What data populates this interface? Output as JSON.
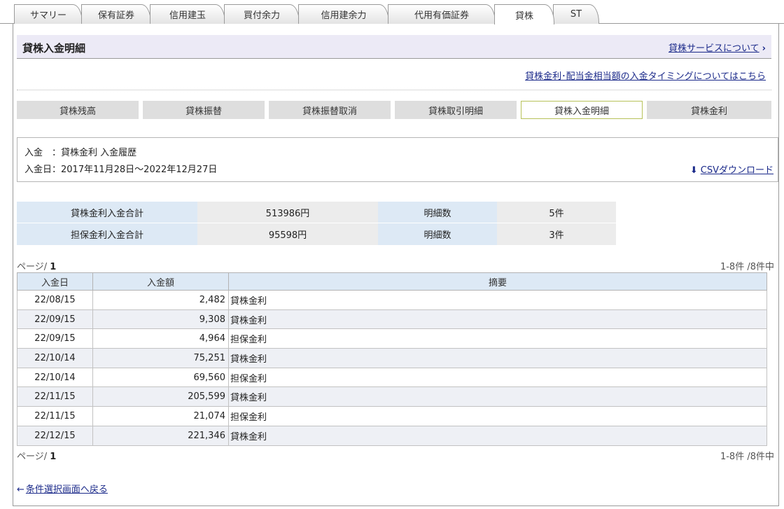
{
  "tabs": [
    "サマリー",
    "保有証券",
    "信用建玉",
    "買付余力",
    "信用建余力",
    "代用有価証券",
    "貸株",
    "ST"
  ],
  "header": {
    "title": "貸株入金明細",
    "service_link": "貸株サービスについて",
    "timing_link": "貸株金利･配当金相当額の入金タイミングについてはこちら"
  },
  "subnav": [
    "貸株残高",
    "貸株振替",
    "貸株振替取消",
    "貸株取引明細",
    "貸株入金明細",
    "貸株金利"
  ],
  "criteria": {
    "line1": "入金　：貸株金利  入金履歴",
    "line2": "入金日：2017年11月28日～2022年12月27日",
    "csv_label": "CSVダウンロード"
  },
  "summary": [
    {
      "label": "貸株金利入金合計",
      "amount": "513986円",
      "count_label": "明細数",
      "count": "5件"
    },
    {
      "label": "担保金利入金合計",
      "amount": "95598円",
      "count_label": "明細数",
      "count": "3件"
    }
  ],
  "pager": {
    "prefix": "ページ/ ",
    "page": "1",
    "range": "1-8件 /8件中"
  },
  "detail": {
    "headers": [
      "入金日",
      "入金額",
      "摘要"
    ],
    "rows": [
      {
        "date": "22/08/15",
        "amount": "2,482",
        "desc": "貸株金利"
      },
      {
        "date": "22/09/15",
        "amount": "9,308",
        "desc": "貸株金利"
      },
      {
        "date": "22/09/15",
        "amount": "4,964",
        "desc": "担保金利"
      },
      {
        "date": "22/10/14",
        "amount": "75,251",
        "desc": "貸株金利"
      },
      {
        "date": "22/10/14",
        "amount": "69,560",
        "desc": "担保金利"
      },
      {
        "date": "22/11/15",
        "amount": "205,599",
        "desc": "貸株金利"
      },
      {
        "date": "22/11/15",
        "amount": "21,074",
        "desc": "担保金利"
      },
      {
        "date": "22/12/15",
        "amount": "221,346",
        "desc": "貸株金利"
      }
    ]
  },
  "back_link": "条件選択画面へ戻る",
  "icons": {
    "service_chevron": "chevron-right-icon",
    "csv": "download-icon",
    "back": "back-arrow-icon"
  },
  "colors": {
    "link": "#1b2a8a",
    "title_bg": "#eceaf6",
    "label_bg": "#dde9f5",
    "active_border": "#b7c25a"
  }
}
